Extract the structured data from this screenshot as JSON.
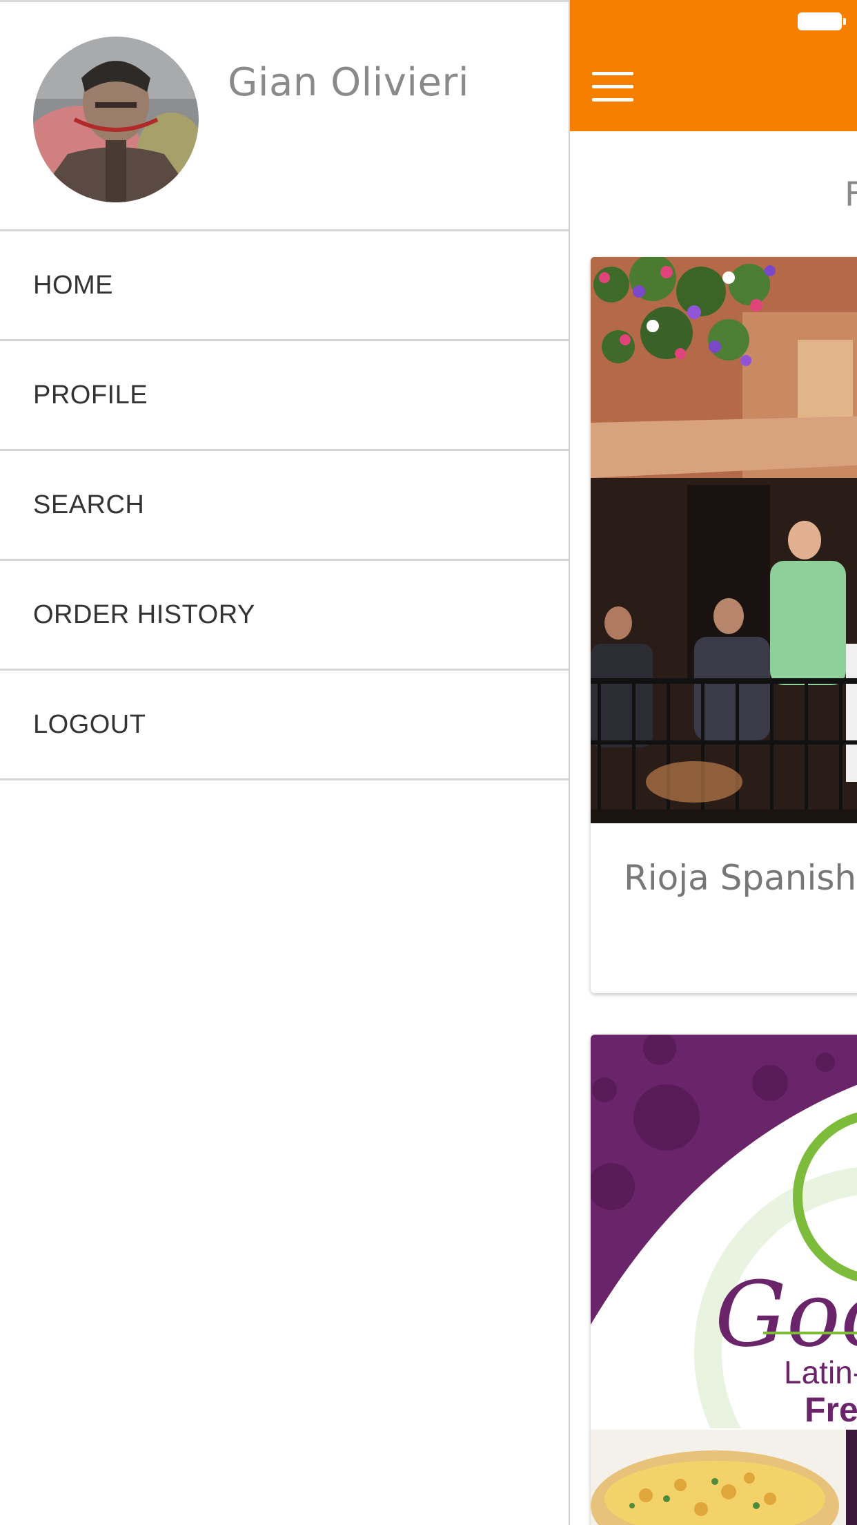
{
  "drawer": {
    "user_name": "Gian Olivieri",
    "menu": [
      {
        "label": "HOME"
      },
      {
        "label": "PROFILE"
      },
      {
        "label": "SEARCH"
      },
      {
        "label": "ORDER HISTORY"
      },
      {
        "label": "LOGOUT"
      }
    ]
  },
  "main": {
    "section_heading_partial": "F",
    "cards": [
      {
        "title": "Rioja Spanish"
      },
      {
        "logo_text_1": "Goc",
        "logo_text_2": "Latin-M",
        "logo_text_3": "Fres"
      }
    ]
  },
  "colors": {
    "accent": "#f77f00",
    "drawer_divider": "#d6d6d6",
    "menu_text": "#333333",
    "name_text": "#8a8a8a",
    "logo_purple": "#6a2469",
    "logo_green": "#7dbb3a"
  },
  "icons": {
    "menu": "hamburger-icon",
    "battery": "battery-icon"
  }
}
